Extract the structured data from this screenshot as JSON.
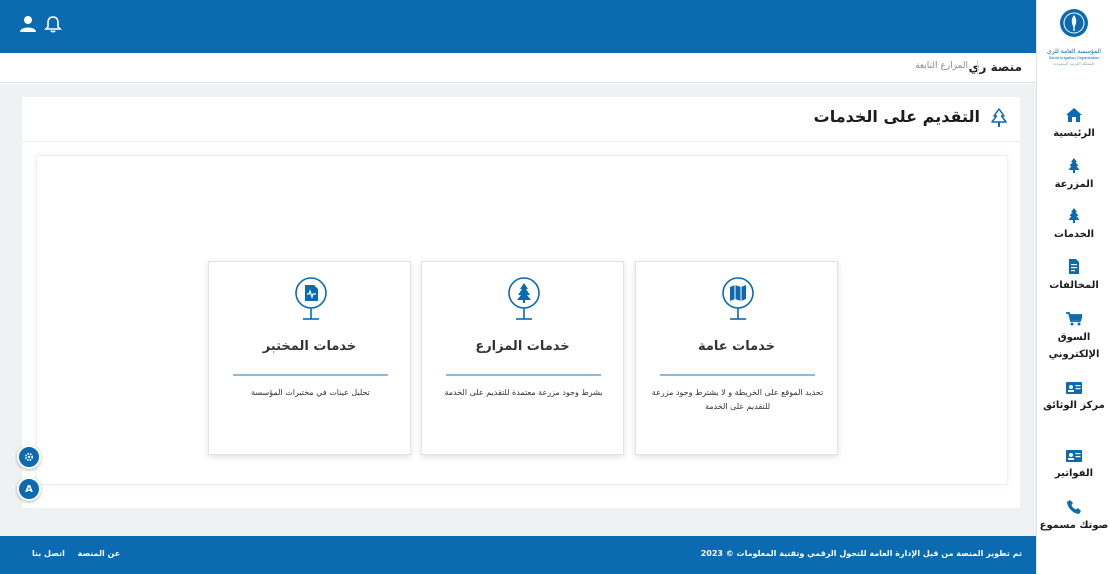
{
  "header": {
    "user_icon": "user-icon",
    "bell_icon": "bell-icon"
  },
  "breadcrumb": {
    "main": "منصة ري",
    "sub": "المزارع التابعة"
  },
  "page": {
    "title": "التقديم على الخدمات",
    "title_icon": "tree-outline-icon"
  },
  "cards": [
    {
      "title": "خدمات المختبر",
      "description": "تحليل عينات في مختبرات المؤسسة",
      "icon": "lab-file-icon"
    },
    {
      "title": "خدمات المزارع",
      "description": "بشرط وجود مزرعة معتمدة للتقديم على الخدمة",
      "icon": "tree-icon"
    },
    {
      "title": "خدمات عامة",
      "description": "تحديد الموقع على الخريطة و لا يشترط وجود مزرعة للتقديم على الخدمة",
      "icon": "map-icon"
    }
  ],
  "footer": {
    "copyright": "تم تطوير المنصة من قبل الإدارة العامة للتحول الرقمي وتقنية المعلومات © 2023",
    "about": "عن المنصة",
    "contact": "اتصل بنا"
  },
  "floating": {
    "settings_icon": "gear-icon",
    "accessibility_label": "A"
  },
  "logo": {
    "line1": "المؤسسة العامة للري",
    "line2": "Saudi Irrigation Organization",
    "line3": "المملكة العربية السعودية"
  },
  "sidebar": {
    "items": [
      {
        "label": "الرئيسية",
        "icon": "home-icon"
      },
      {
        "label": "المزرعة",
        "icon": "tree-icon"
      },
      {
        "label": "الخدمات",
        "icon": "tree-icon"
      },
      {
        "label": "المخالفات",
        "icon": "document-icon"
      },
      {
        "label": "السوق الإلكتروني",
        "icon": "cart-icon"
      },
      {
        "label": "مركز الوثائق",
        "icon": "id-card-icon"
      },
      {
        "label": "الفواتير",
        "icon": "id-card-icon"
      },
      {
        "label": "صوتك مسموع",
        "icon": "phone-icon"
      }
    ]
  },
  "colors": {
    "primary": "#0b6ab0",
    "background": "#f0f1f3",
    "divider": "#8fb8da"
  }
}
